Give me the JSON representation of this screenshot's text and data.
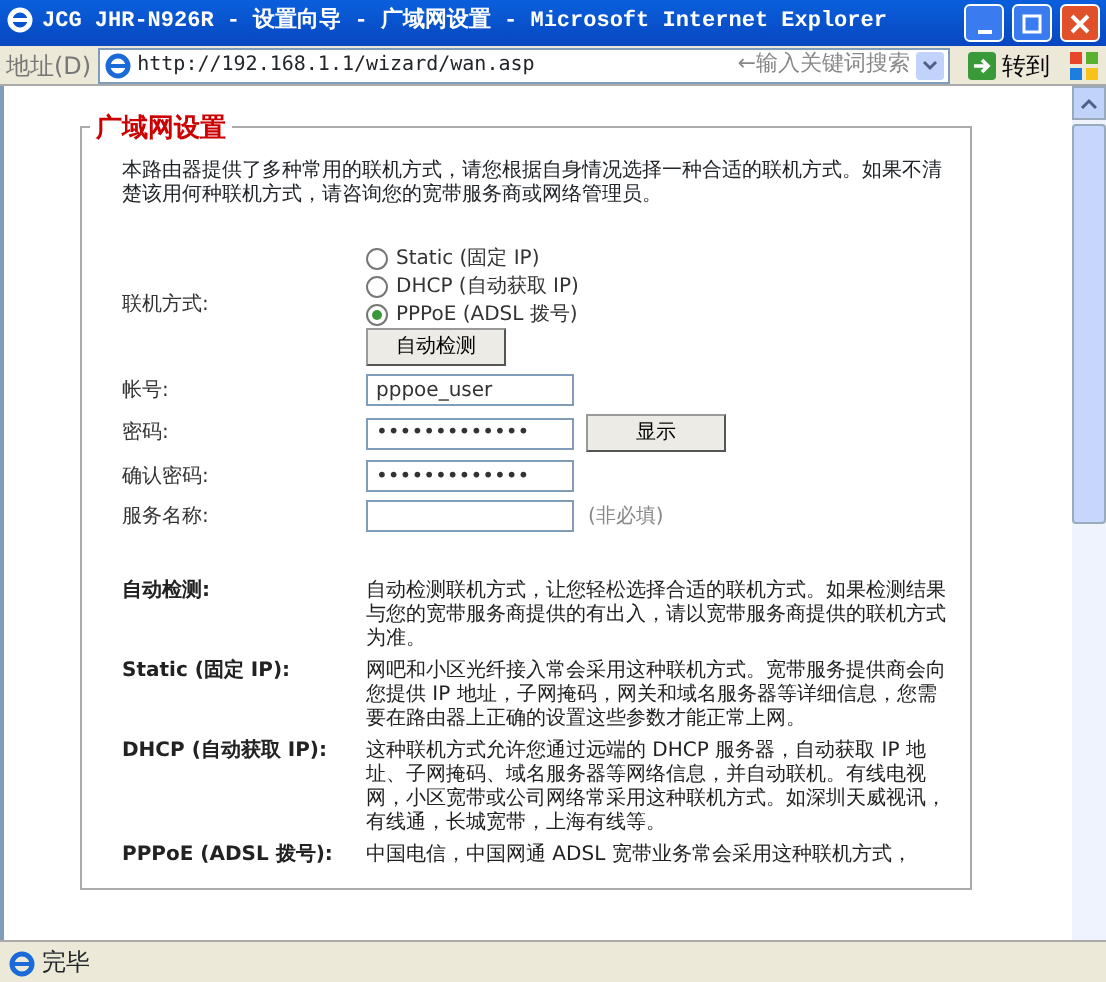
{
  "window": {
    "title": "JCG JHR-N926R - 设置向导 - 广域网设置 - Microsoft Internet Explorer"
  },
  "address_bar": {
    "label": "地址(D)",
    "url": "http://192.168.1.1/wizard/wan.asp",
    "search_hint": "←输入关键词搜索",
    "go_button": "转到"
  },
  "page": {
    "legend": "广域网设置",
    "intro": "本路由器提供了多种常用的联机方式，请您根据自身情况选择一种合适的联机方式。如果不清楚该用何种联机方式，请咨询您的宽带服务商或网络管理员。",
    "connection": {
      "label": "联机方式:",
      "options": [
        {
          "label": "Static (固定 IP)",
          "selected": false
        },
        {
          "label": "DHCP (自动获取 IP)",
          "selected": false
        },
        {
          "label": "PPPoE (ADSL 拨号)",
          "selected": true
        }
      ],
      "detect_button": "自动检测"
    },
    "fields": [
      {
        "label": "帐号:",
        "value": "pppoe_user"
      },
      {
        "label": "密码:",
        "value": "•••••••••••••",
        "button": "显示"
      },
      {
        "label": "确认密码:",
        "value": "•••••••••••••"
      },
      {
        "label": "服务名称:",
        "note": "(非必填)"
      }
    ],
    "descriptions": [
      {
        "term": "自动检测:",
        "text": "自动检测联机方式，让您轻松选择合适的联机方式。如果检测结果与您的宽带服务商提供的有出入，请以宽带服务商提供的联机方式为准。"
      },
      {
        "term": "Static (固定 IP):",
        "text": "网吧和小区光纤接入常会采用这种联机方式。宽带服务提供商会向您提供 IP 地址，子网掩码，网关和域名服务器等详细信息，您需要在路由器上正确的设置这些参数才能正常上网。"
      },
      {
        "term": "DHCP (自动获取 IP):",
        "text": "这种联机方式允许您通过远端的 DHCP 服务器，自动获取 IP 地址、子网掩码、域名服务器等网络信息，并自动联机。有线电视网，小区宽带或公司网络常采用这种联机方式。如深圳天威视讯，有线通，长城宽带，上海有线等。"
      },
      {
        "term": "PPPoE (ADSL 拨号):",
        "text": "中国电信，中国网通 ADSL 宽带业务常会采用这种联机方式，"
      }
    ]
  },
  "status_bar": {
    "text": "完毕"
  }
}
